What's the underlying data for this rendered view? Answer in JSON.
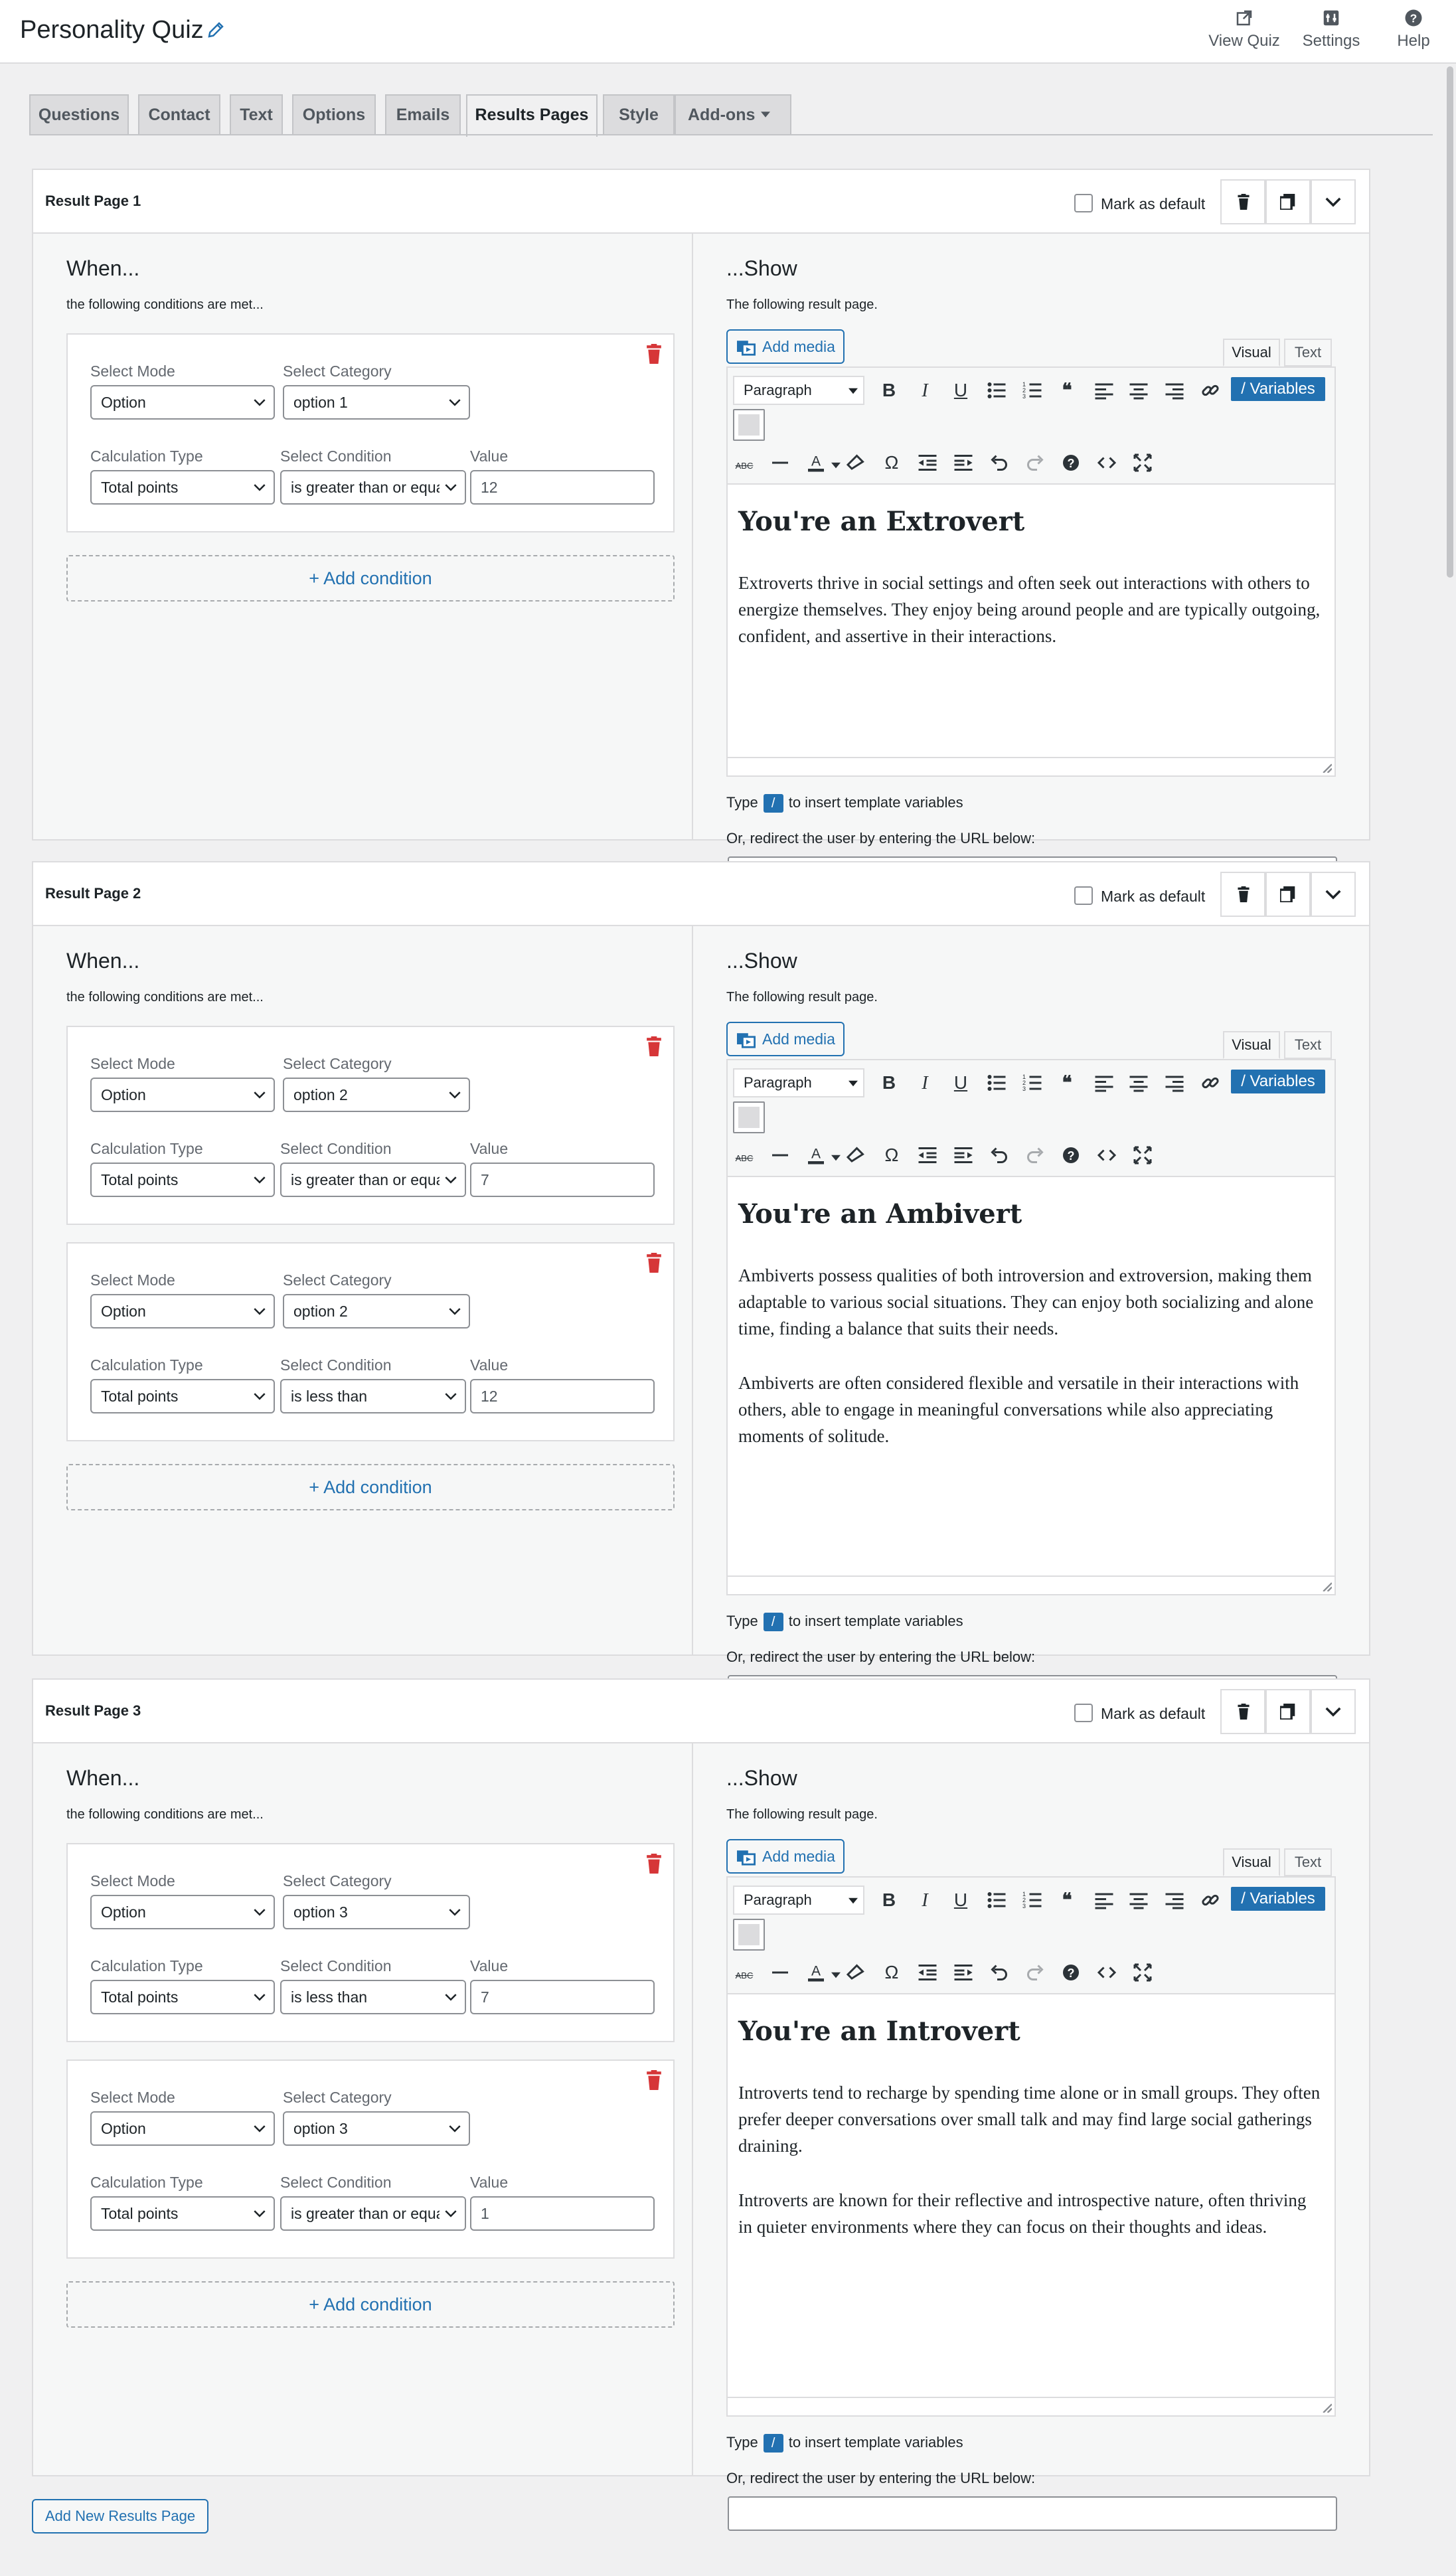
{
  "header": {
    "title": "Personality Quiz",
    "actions": [
      {
        "label": "View Quiz",
        "icon": "external-link-icon"
      },
      {
        "label": "Settings",
        "icon": "settings-icon"
      },
      {
        "label": "Help",
        "icon": "help-icon"
      }
    ]
  },
  "tabs": [
    {
      "label": "Questions",
      "active": false
    },
    {
      "label": "Contact",
      "active": false
    },
    {
      "label": "Text",
      "active": false
    },
    {
      "label": "Options",
      "active": false
    },
    {
      "label": "Emails",
      "active": false
    },
    {
      "label": "Results Pages",
      "active": true
    },
    {
      "label": "Style",
      "active": false
    },
    {
      "label": "Add-ons",
      "active": false
    }
  ],
  "labels": {
    "mark_default": "Mark as default",
    "when": "When...",
    "when_sub": "the following conditions are met...",
    "show": "...Show",
    "show_sub": "The following result page.",
    "add_media": "Add media",
    "visual": "Visual",
    "text": "Text",
    "paragraph": "Paragraph",
    "variables": "/ Variables",
    "select_mode": "Select Mode",
    "select_category": "Select Category",
    "calc_type": "Calculation Type",
    "select_condition": "Select Condition",
    "value": "Value",
    "add_condition": "+ Add condition",
    "hint_type": "Type",
    "hint_slash": "/",
    "hint_rest": "to insert template variables",
    "redirect": "Or, redirect the user by entering the URL below:",
    "add_new_page": "Add New Results Page"
  },
  "result_pages": [
    {
      "title": "Result Page 1",
      "conditions": [
        {
          "mode": "Option",
          "category": "option 1",
          "calc": "Total points",
          "condition": "is greater than or equal to",
          "value": "12"
        }
      ],
      "heading": "You're an Extrovert",
      "paragraphs": [
        "Extroverts thrive in social settings and often seek out interactions with others to energize themselves. They enjoy being around people and are typically outgoing, confident, and assertive in their interactions."
      ],
      "redirect_url": ""
    },
    {
      "title": "Result Page 2",
      "conditions": [
        {
          "mode": "Option",
          "category": "option 2",
          "calc": "Total points",
          "condition": "is greater than or equal to",
          "value": "7"
        },
        {
          "mode": "Option",
          "category": "option 2",
          "calc": "Total points",
          "condition": "is less than",
          "value": "12"
        }
      ],
      "heading": "You're an Ambivert",
      "paragraphs": [
        "Ambiverts possess qualities of both introversion and extroversion, making them adaptable to various social situations. They can enjoy both socializing and alone time, finding a balance that suits their needs.",
        "Ambiverts are often considered flexible and versatile in their interactions with others, able to engage in meaningful conversations while also appreciating moments of solitude."
      ],
      "redirect_url": ""
    },
    {
      "title": "Result Page 3",
      "conditions": [
        {
          "mode": "Option",
          "category": "option 3",
          "calc": "Total points",
          "condition": "is less than",
          "value": "7"
        },
        {
          "mode": "Option",
          "category": "option 3",
          "calc": "Total points",
          "condition": "is greater than or equal to",
          "value": "1"
        }
      ],
      "heading": "You're an Introvert",
      "paragraphs": [
        "Introverts tend to recharge by spending time alone or in small groups. They often prefer deeper conversations over small talk and may find large social gatherings draining.",
        "Introverts are known for their reflective and introspective nature, often thriving in quieter environments where they can focus on their thoughts and ideas."
      ],
      "redirect_url": ""
    }
  ],
  "colors": {
    "accent": "#2271b1",
    "danger": "#d63638",
    "background": "#f0f0f1"
  }
}
